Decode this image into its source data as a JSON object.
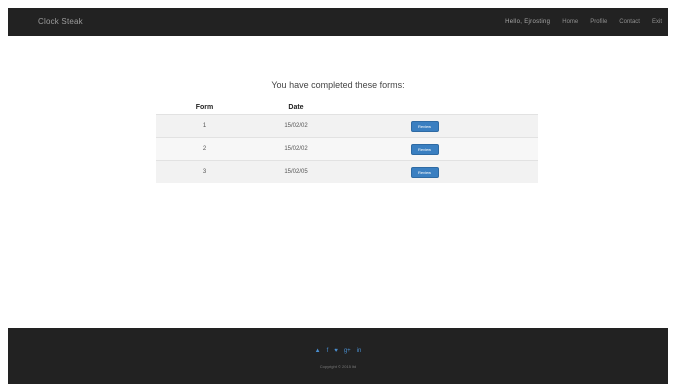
{
  "navbar": {
    "brand": "Clock Steak",
    "greeting": "Hello, Ejrosting",
    "links": [
      "Home",
      "Profile",
      "Contact",
      "Exit"
    ]
  },
  "main": {
    "heading": "You have completed these forms:",
    "table": {
      "headers": [
        "Form",
        "Date",
        ""
      ],
      "rows": [
        {
          "form": "1",
          "date": "15/02/02",
          "action": "Review"
        },
        {
          "form": "2",
          "date": "15/02/02",
          "action": "Review"
        },
        {
          "form": "3",
          "date": "15/02/05",
          "action": "Review"
        }
      ]
    }
  },
  "footer": {
    "social_icons": [
      "rss-icon",
      "facebook-icon",
      "twitter-icon",
      "google-plus-icon",
      "linkedin-icon"
    ],
    "social_glyphs": [
      "▲",
      "f",
      "♥",
      "g+",
      "in"
    ],
    "copyright": "Copyright © 2015 ltd"
  },
  "colors": {
    "navbar_bg": "#222222",
    "button_bg": "#3a7fc1",
    "social_icon": "#4a8fd0"
  }
}
